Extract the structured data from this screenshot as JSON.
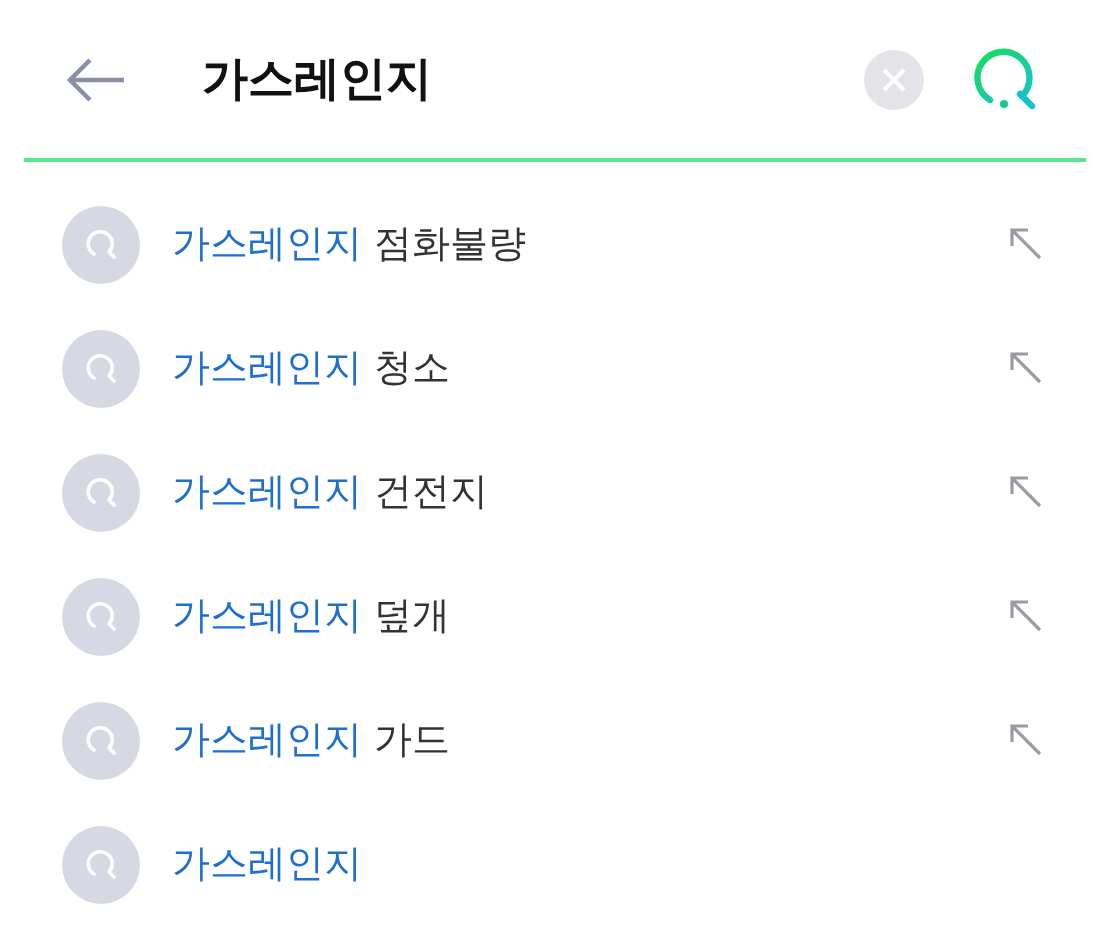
{
  "search": {
    "value": "가스레인지"
  },
  "suggestions": [
    {
      "match": "가스레인지",
      "rest": "점화불량",
      "fill_arrow": true
    },
    {
      "match": "가스레인지",
      "rest": "청소",
      "fill_arrow": true
    },
    {
      "match": "가스레인지",
      "rest": "건전지",
      "fill_arrow": true
    },
    {
      "match": "가스레인지",
      "rest": "덮개",
      "fill_arrow": true
    },
    {
      "match": "가스레인지",
      "rest": "가드",
      "fill_arrow": true
    },
    {
      "match": "가스레인지",
      "fill_arrow": false
    }
  ]
}
